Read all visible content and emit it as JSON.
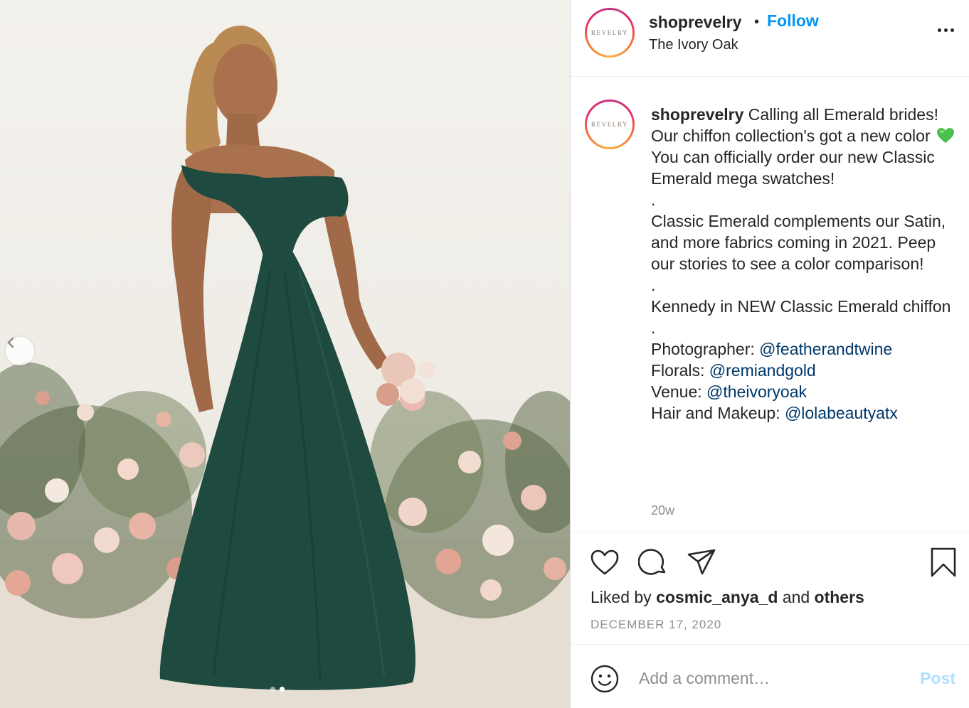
{
  "post": {
    "photo_alt": "",
    "carousel": {
      "total": 2,
      "active": 2
    }
  },
  "header": {
    "username": "shoprevelry",
    "separator": "•",
    "follow_label": "Follow",
    "location": "The Ivory Oak",
    "avatar_text": "REVELRY"
  },
  "caption": {
    "username": "shoprevelry",
    "line1_before_emoji": "Calling all Emerald brides! Our chiffon collection's got a new color",
    "line1_after_emoji": "You can officially order our new Classic Emerald mega swatches!",
    "dot1": ".",
    "para2": "Classic Emerald complements our Satin, and more fabrics coming in 2021. Peep our stories to see a color comparison!",
    "dot2": ".",
    "para3": "Kennedy in NEW Classic Emerald chiffon",
    "dot3": ".",
    "credits": [
      {
        "label": "Photographer: ",
        "handle": "@featherandtwine"
      },
      {
        "label": "Florals: ",
        "handle": "@remiandgold"
      },
      {
        "label": "Venue: ",
        "handle": "@theivoryoak"
      },
      {
        "label": "Hair and Makeup: ",
        "handle": "@lolabeautyatx"
      }
    ],
    "time_ago": "20w"
  },
  "actions": {
    "liked_by_prefix": "Liked by ",
    "liked_by_user": "cosmic_anya_d",
    "liked_by_middle": " and ",
    "liked_by_others": "others",
    "date": "DECEMBER 17, 2020"
  },
  "comment": {
    "placeholder": "Add a comment…",
    "post_label": "Post"
  },
  "colors": {
    "follow_blue": "#0095f6",
    "mention_blue": "#00376b",
    "muted": "#8e8e8e",
    "post_disabled": "#b2dffc",
    "dress_green": "#1f4a40",
    "emoji_green": "#4cc04c"
  }
}
